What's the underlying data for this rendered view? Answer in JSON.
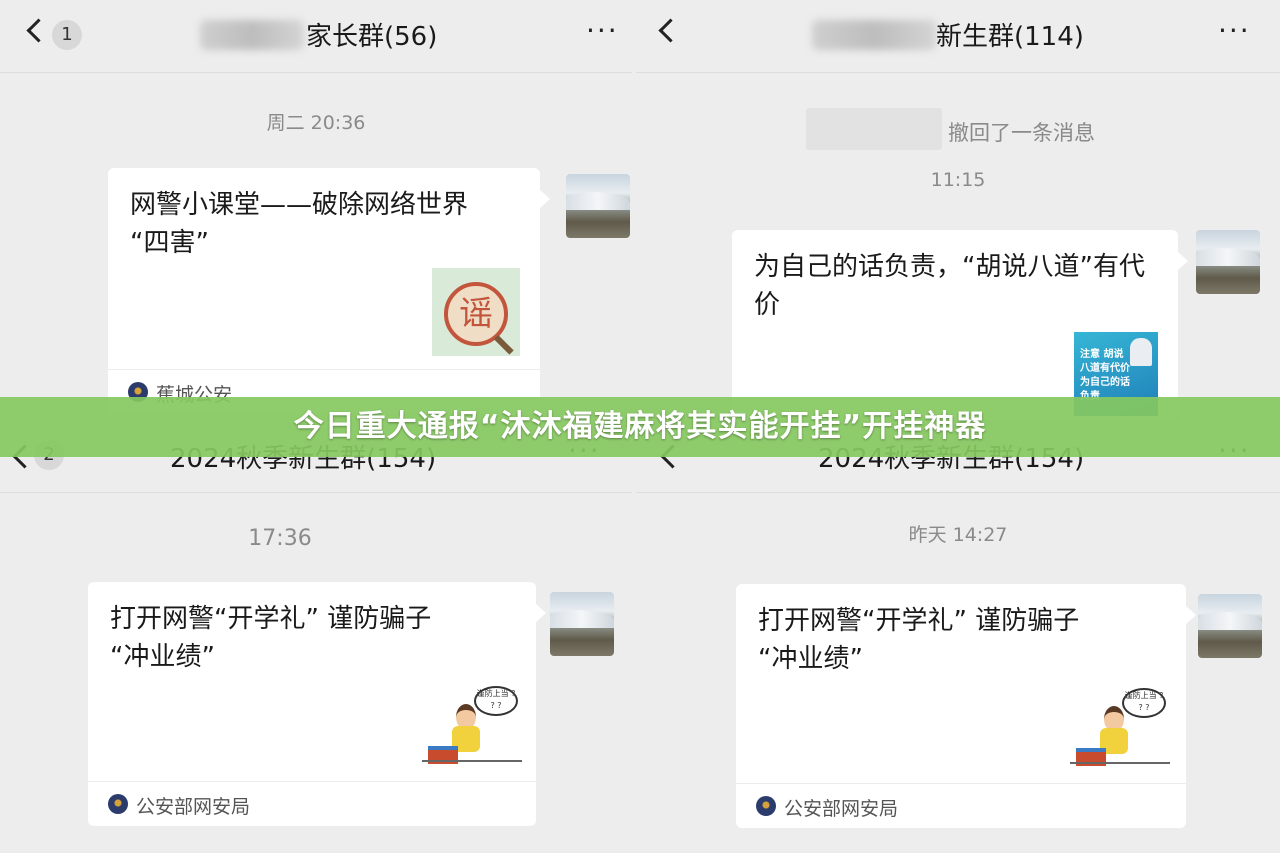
{
  "panels": [
    {
      "title": "家长群(56)",
      "badge": "1",
      "more": "···",
      "timestamp": "周二 20:36",
      "card": {
        "title": "网警小课堂——破除网络世界\n“四害”",
        "thumb_char": "谣",
        "source": "蕉城公安"
      }
    },
    {
      "title": "新生群(114)",
      "more": "···",
      "recall": "撤回了一条消息",
      "timestamp": "11:15",
      "card": {
        "title": "为自己的话负责，“胡说八道”有代\n价",
        "thumb_text": "注意 胡说八道有代价 为自己的话负责"
      }
    },
    {
      "title": "2024秋季新生群(154)",
      "badge": "2",
      "more": "···",
      "timestamp": "17:36",
      "card": {
        "title": "打开网警“开学礼” 谨防骗子\n“冲业绩”",
        "bubble": "谨防上当 ? ? ?",
        "source": "公安部网安局"
      }
    },
    {
      "title": "2024秋季新生群(154)",
      "more": "···",
      "timestamp": "昨天 14:27",
      "card": {
        "title": "打开网警“开学礼” 谨防骗子\n“冲业绩”",
        "bubble": "谨防上当 ? ? ?",
        "source": "公安部网安局"
      }
    }
  ],
  "banner": "今日重大通报“沐沐福建麻将其实能开挂”开挂神器"
}
